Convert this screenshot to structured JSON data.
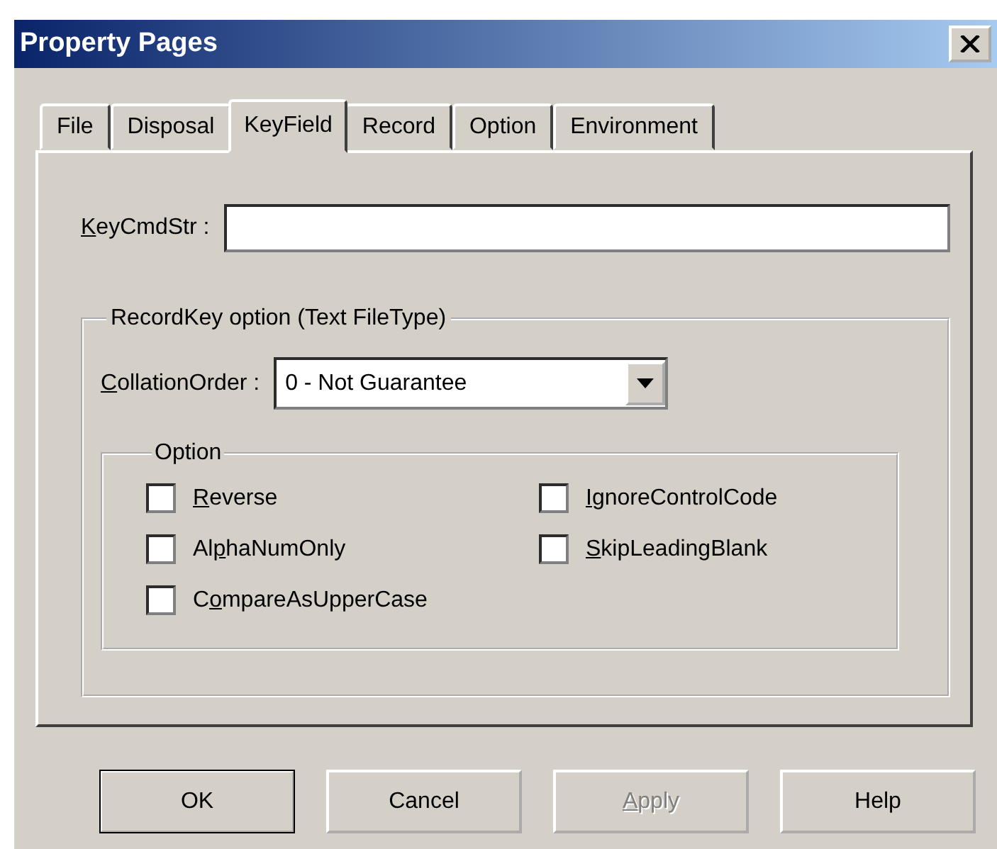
{
  "window": {
    "title": "Property Pages"
  },
  "tabs": [
    {
      "label": "File",
      "selected": false
    },
    {
      "label": "Disposal",
      "selected": false
    },
    {
      "label": "KeyField",
      "selected": true
    },
    {
      "label": "Record",
      "selected": false
    },
    {
      "label": "Option",
      "selected": false
    },
    {
      "label": "Environment",
      "selected": false
    }
  ],
  "key_cmd_str": {
    "label": {
      "key": "K",
      "after": "eyCmdStr :"
    }
  },
  "record_key_group": {
    "title": "RecordKey option (Text FileType)",
    "collation_order": {
      "label": {
        "key": "C",
        "after": "ollationOrder :"
      },
      "value": "0 - Not Guarantee"
    },
    "option_group": {
      "title": "Option",
      "checkboxes": [
        {
          "label": {
            "key": "R",
            "after": "everse"
          },
          "checked": false
        },
        {
          "label": {
            "key": "I",
            "after": "gnoreControlCode"
          },
          "checked": false
        },
        {
          "label": {
            "before": "Al",
            "key": "p",
            "after": "haNumOnly"
          },
          "checked": false
        },
        {
          "label": {
            "key": "S",
            "after": "kipLeadingBlank"
          },
          "checked": false
        },
        {
          "label": {
            "before": "C",
            "key": "o",
            "after": "mpareAsUpperCase"
          },
          "checked": false
        }
      ]
    }
  },
  "buttons": [
    {
      "label": {
        "before": "OK"
      },
      "default": true,
      "disabled": false
    },
    {
      "label": {
        "before": "Cancel"
      },
      "default": false,
      "disabled": false
    },
    {
      "label": {
        "key": "A",
        "after": "pply"
      },
      "default": false,
      "disabled": true
    },
    {
      "label": {
        "before": "Help"
      },
      "default": false,
      "disabled": false
    }
  ]
}
